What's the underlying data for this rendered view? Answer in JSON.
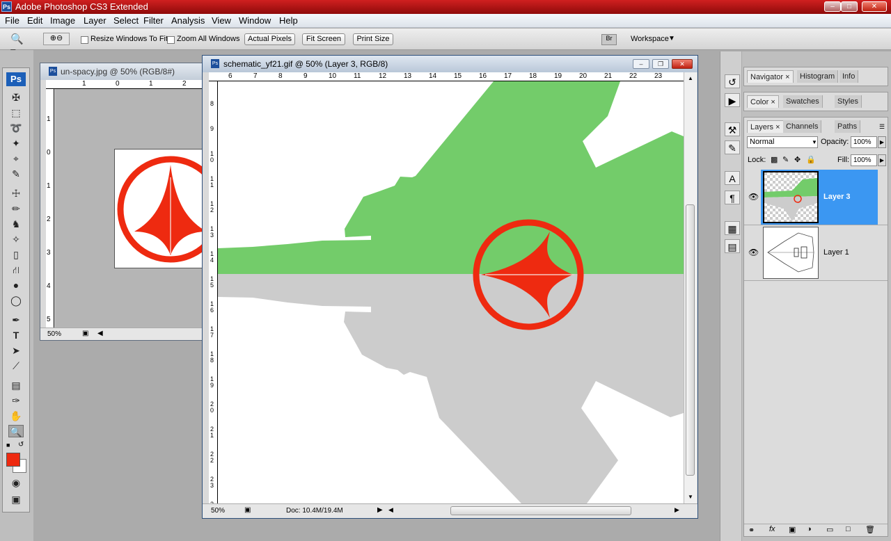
{
  "app": {
    "title": "Adobe Photoshop CS3 Extended",
    "icon": "Ps"
  },
  "menu": [
    "File",
    "Edit",
    "Image",
    "Layer",
    "Select",
    "Filter",
    "Analysis",
    "View",
    "Window",
    "Help"
  ],
  "options": {
    "resize_windows": "Resize Windows To Fit",
    "zoom_all": "Zoom All Windows",
    "actual_pixels": "Actual Pixels",
    "fit_screen": "Fit Screen",
    "print_size": "Print Size",
    "workspace": "Workspace"
  },
  "toolbox": {
    "logo": "Ps",
    "foreground_color": "#ee2a10",
    "background_color": "#ffffff"
  },
  "doc1": {
    "title": "un-spacy.jpg @ 50% (RGB/8#)",
    "zoom": "50%",
    "ruler_h": [
      "1",
      "0",
      "1",
      "2"
    ],
    "ruler_v": [
      "1",
      "0",
      "1",
      "2",
      "3",
      "4",
      "5"
    ]
  },
  "doc2": {
    "title": "schematic_yf21.gif @ 50% (Layer 3, RGB/8)",
    "zoom": "50%",
    "doc_size": "Doc: 10.4M/19.4M",
    "ruler_h": [
      "6",
      "7",
      "8",
      "9",
      "10",
      "11",
      "12",
      "13",
      "14",
      "15",
      "16",
      "17",
      "18",
      "19",
      "20",
      "21",
      "22",
      "23"
    ],
    "ruler_v": [
      "8",
      "9",
      "10",
      "11",
      "12",
      "13",
      "14",
      "15",
      "16",
      "17",
      "18",
      "19",
      "20",
      "21",
      "22",
      "23",
      "24"
    ]
  },
  "colors": {
    "logo_red": "#ee2a10",
    "upper_half": "#73cc6a",
    "lower_half": "#cccccc",
    "selected_layer": "#3b97f2"
  },
  "panels": {
    "group1": [
      "Navigator",
      "Histogram",
      "Info"
    ],
    "group2": [
      "Color",
      "Swatches",
      "Styles"
    ],
    "group3": [
      "Layers",
      "Channels",
      "Paths"
    ],
    "blend_mode": "Normal",
    "opacity_label": "Opacity:",
    "opacity_value": "100%",
    "lock_label": "Lock:",
    "fill_label": "Fill:",
    "fill_value": "100%",
    "layers": [
      {
        "name": "Layer 3",
        "selected": true
      },
      {
        "name": "Layer 1",
        "selected": false
      }
    ]
  }
}
